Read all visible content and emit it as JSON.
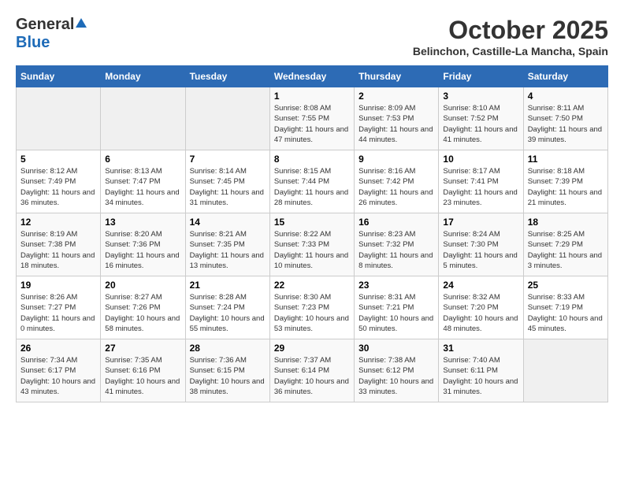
{
  "header": {
    "logo_general": "General",
    "logo_blue": "Blue",
    "month": "October 2025",
    "location": "Belinchon, Castille-La Mancha, Spain"
  },
  "days_of_week": [
    "Sunday",
    "Monday",
    "Tuesday",
    "Wednesday",
    "Thursday",
    "Friday",
    "Saturday"
  ],
  "weeks": [
    [
      {
        "day": "",
        "info": ""
      },
      {
        "day": "",
        "info": ""
      },
      {
        "day": "",
        "info": ""
      },
      {
        "day": "1",
        "info": "Sunrise: 8:08 AM\nSunset: 7:55 PM\nDaylight: 11 hours and 47 minutes."
      },
      {
        "day": "2",
        "info": "Sunrise: 8:09 AM\nSunset: 7:53 PM\nDaylight: 11 hours and 44 minutes."
      },
      {
        "day": "3",
        "info": "Sunrise: 8:10 AM\nSunset: 7:52 PM\nDaylight: 11 hours and 41 minutes."
      },
      {
        "day": "4",
        "info": "Sunrise: 8:11 AM\nSunset: 7:50 PM\nDaylight: 11 hours and 39 minutes."
      }
    ],
    [
      {
        "day": "5",
        "info": "Sunrise: 8:12 AM\nSunset: 7:49 PM\nDaylight: 11 hours and 36 minutes."
      },
      {
        "day": "6",
        "info": "Sunrise: 8:13 AM\nSunset: 7:47 PM\nDaylight: 11 hours and 34 minutes."
      },
      {
        "day": "7",
        "info": "Sunrise: 8:14 AM\nSunset: 7:45 PM\nDaylight: 11 hours and 31 minutes."
      },
      {
        "day": "8",
        "info": "Sunrise: 8:15 AM\nSunset: 7:44 PM\nDaylight: 11 hours and 28 minutes."
      },
      {
        "day": "9",
        "info": "Sunrise: 8:16 AM\nSunset: 7:42 PM\nDaylight: 11 hours and 26 minutes."
      },
      {
        "day": "10",
        "info": "Sunrise: 8:17 AM\nSunset: 7:41 PM\nDaylight: 11 hours and 23 minutes."
      },
      {
        "day": "11",
        "info": "Sunrise: 8:18 AM\nSunset: 7:39 PM\nDaylight: 11 hours and 21 minutes."
      }
    ],
    [
      {
        "day": "12",
        "info": "Sunrise: 8:19 AM\nSunset: 7:38 PM\nDaylight: 11 hours and 18 minutes."
      },
      {
        "day": "13",
        "info": "Sunrise: 8:20 AM\nSunset: 7:36 PM\nDaylight: 11 hours and 16 minutes."
      },
      {
        "day": "14",
        "info": "Sunrise: 8:21 AM\nSunset: 7:35 PM\nDaylight: 11 hours and 13 minutes."
      },
      {
        "day": "15",
        "info": "Sunrise: 8:22 AM\nSunset: 7:33 PM\nDaylight: 11 hours and 10 minutes."
      },
      {
        "day": "16",
        "info": "Sunrise: 8:23 AM\nSunset: 7:32 PM\nDaylight: 11 hours and 8 minutes."
      },
      {
        "day": "17",
        "info": "Sunrise: 8:24 AM\nSunset: 7:30 PM\nDaylight: 11 hours and 5 minutes."
      },
      {
        "day": "18",
        "info": "Sunrise: 8:25 AM\nSunset: 7:29 PM\nDaylight: 11 hours and 3 minutes."
      }
    ],
    [
      {
        "day": "19",
        "info": "Sunrise: 8:26 AM\nSunset: 7:27 PM\nDaylight: 11 hours and 0 minutes."
      },
      {
        "day": "20",
        "info": "Sunrise: 8:27 AM\nSunset: 7:26 PM\nDaylight: 10 hours and 58 minutes."
      },
      {
        "day": "21",
        "info": "Sunrise: 8:28 AM\nSunset: 7:24 PM\nDaylight: 10 hours and 55 minutes."
      },
      {
        "day": "22",
        "info": "Sunrise: 8:30 AM\nSunset: 7:23 PM\nDaylight: 10 hours and 53 minutes."
      },
      {
        "day": "23",
        "info": "Sunrise: 8:31 AM\nSunset: 7:21 PM\nDaylight: 10 hours and 50 minutes."
      },
      {
        "day": "24",
        "info": "Sunrise: 8:32 AM\nSunset: 7:20 PM\nDaylight: 10 hours and 48 minutes."
      },
      {
        "day": "25",
        "info": "Sunrise: 8:33 AM\nSunset: 7:19 PM\nDaylight: 10 hours and 45 minutes."
      }
    ],
    [
      {
        "day": "26",
        "info": "Sunrise: 7:34 AM\nSunset: 6:17 PM\nDaylight: 10 hours and 43 minutes."
      },
      {
        "day": "27",
        "info": "Sunrise: 7:35 AM\nSunset: 6:16 PM\nDaylight: 10 hours and 41 minutes."
      },
      {
        "day": "28",
        "info": "Sunrise: 7:36 AM\nSunset: 6:15 PM\nDaylight: 10 hours and 38 minutes."
      },
      {
        "day": "29",
        "info": "Sunrise: 7:37 AM\nSunset: 6:14 PM\nDaylight: 10 hours and 36 minutes."
      },
      {
        "day": "30",
        "info": "Sunrise: 7:38 AM\nSunset: 6:12 PM\nDaylight: 10 hours and 33 minutes."
      },
      {
        "day": "31",
        "info": "Sunrise: 7:40 AM\nSunset: 6:11 PM\nDaylight: 10 hours and 31 minutes."
      },
      {
        "day": "",
        "info": ""
      }
    ]
  ]
}
